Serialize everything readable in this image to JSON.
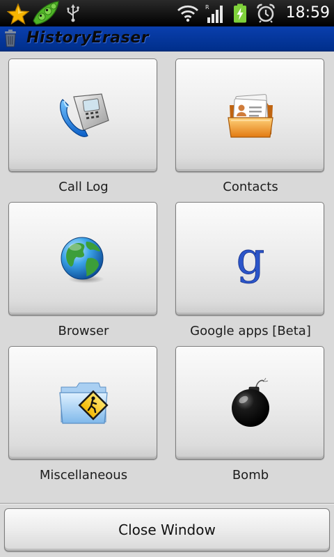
{
  "status_bar": {
    "time": "18:59",
    "icons": [
      "star-icon",
      "peapod-icon",
      "usb-icon",
      "wifi-icon",
      "signal-icon",
      "battery-charging-icon",
      "alarm-icon"
    ],
    "colors": {
      "background": "#000000",
      "battery": "#7fd13b",
      "star": "#f5b400"
    }
  },
  "title_bar": {
    "title": "HistoryEraser",
    "icon": "trash-bin-icon",
    "background": "#0a3fae"
  },
  "tiles": [
    {
      "label": "Call Log",
      "icon": "telephone-icon"
    },
    {
      "label": "Contacts",
      "icon": "contacts-folder-icon"
    },
    {
      "label": "Browser",
      "icon": "globe-icon"
    },
    {
      "label": "Google apps [Beta]",
      "icon": "google-g-icon"
    },
    {
      "label": "Miscellaneous",
      "icon": "folder-warning-icon"
    },
    {
      "label": "Bomb",
      "icon": "bomb-icon"
    }
  ],
  "footer": {
    "close_label": "Close Window"
  },
  "colors": {
    "background": "#d9d9d9",
    "tile": "#ececec"
  }
}
